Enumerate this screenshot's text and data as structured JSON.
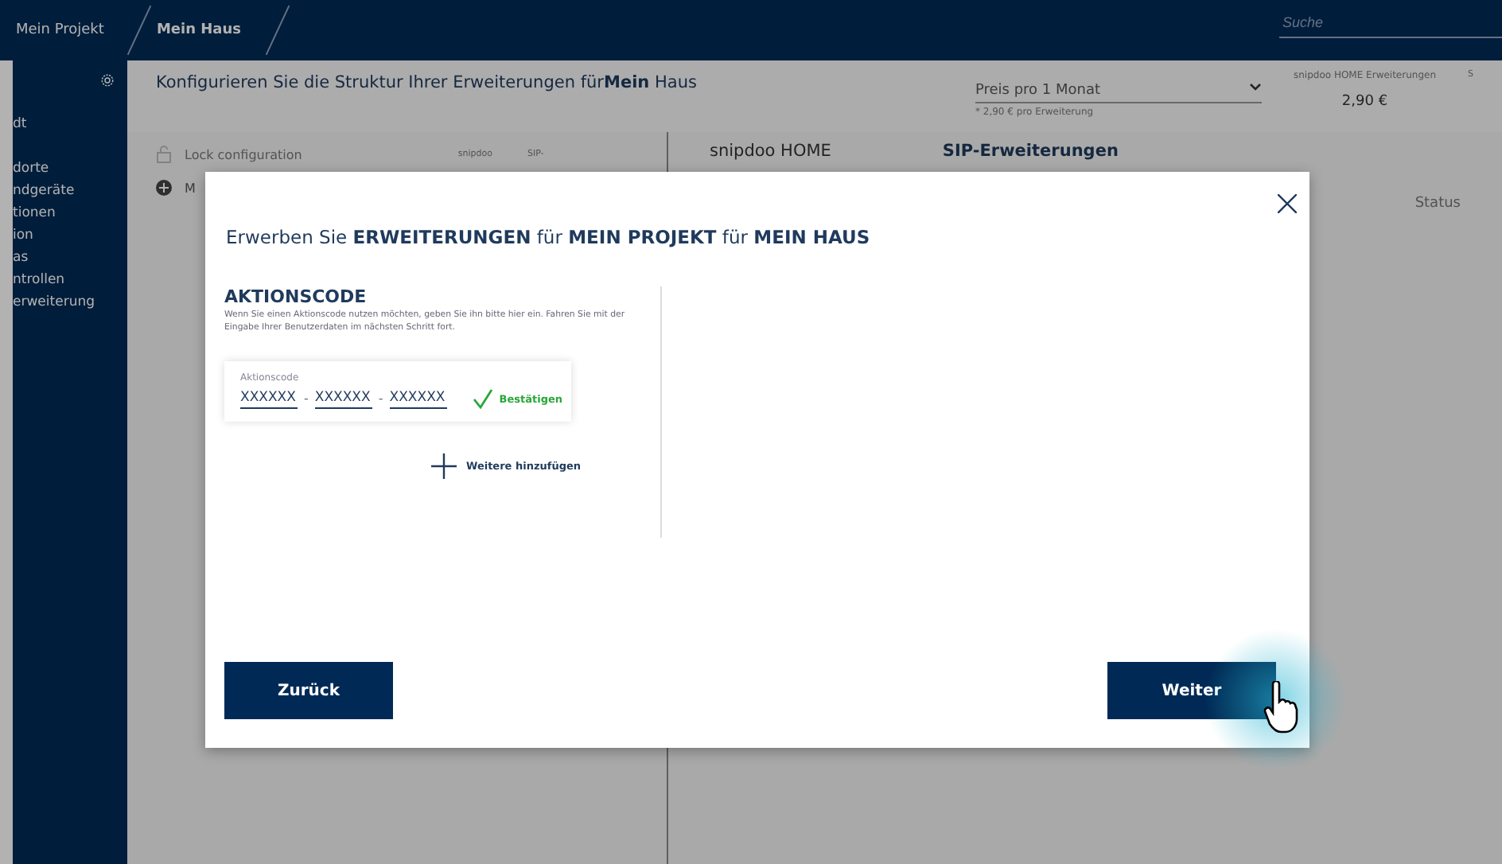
{
  "topbar": {
    "breadcrumbs": [
      {
        "label": "Mein Projekt",
        "selected": false
      },
      {
        "label": "Mein Haus",
        "selected": true
      }
    ],
    "search": {
      "placeholder": "Suche"
    }
  },
  "sidebar": {
    "items": [
      "dt",
      "dorte",
      "ndgeräte",
      "tionen",
      "ion",
      "as",
      "ntrollen",
      "erweiterung"
    ]
  },
  "page": {
    "heading": "Konfigurieren Sie die Struktur Ihrer Erweiterungen für**Mein** Haus",
    "lock": "Lock configuration",
    "columns": [
      "snipdoo",
      "SIP-"
    ],
    "tree_label": "M",
    "price": {
      "select": "Preis pro 1 Monat",
      "note": "* 2,90 € pro Erweiterung",
      "summary_label": "snipdoo HOME Erweiterungen",
      "summary_value": "2,90 €",
      "summary_cut": "S"
    },
    "tabs": [
      "snipdoo HOME",
      "SIP-Erweiterungen"
    ],
    "status_header": "Status"
  },
  "dialog": {
    "title": "Erwerben Sie **ERWEITERUNGEN** für **MEIN PROJEKT** für **MEIN HAUS**",
    "section": "AKTIONSCODE",
    "description": "Wenn Sie einen Aktionscode nutzen möchten, geben Sie ihn bitte hier ein. Fahren Sie mit der Eingabe Ihrer Benutzerdaten im nächsten Schritt fort.",
    "code": {
      "label": "Aktionscode",
      "parts": [
        "XXXXXX",
        "XXXXXX",
        "XXXXXX"
      ],
      "separator": "-",
      "confirm": "Bestätigen"
    },
    "add": "Weitere hinzufügen",
    "back": "Zurück",
    "next": "Weiter"
  }
}
